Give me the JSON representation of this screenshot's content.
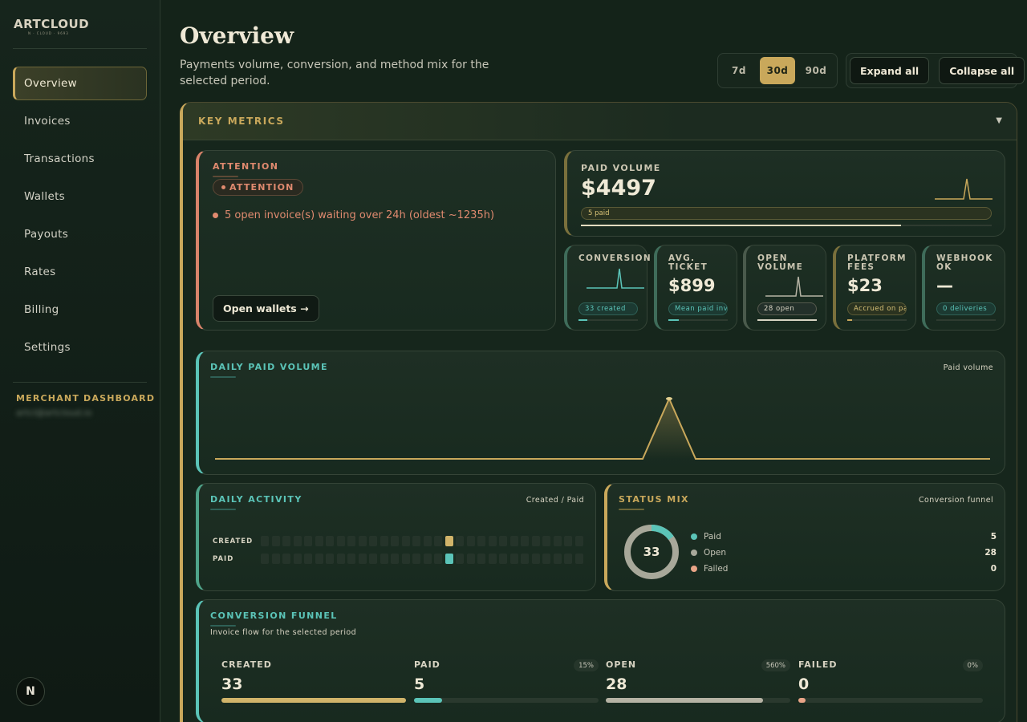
{
  "brand": {
    "logo_main": "ARTCLOUD",
    "logo_sub": "N · CLOUD · 9693"
  },
  "sidebar": {
    "items": [
      {
        "label": "Overview",
        "active": true
      },
      {
        "label": "Invoices"
      },
      {
        "label": "Transactions"
      },
      {
        "label": "Wallets"
      },
      {
        "label": "Payouts"
      },
      {
        "label": "Rates"
      },
      {
        "label": "Billing"
      },
      {
        "label": "Settings"
      }
    ],
    "merchant_label": "MERCHANT DASHBOARD",
    "merchant_email": "artcl@artcloud.io",
    "avatar_initial": "N"
  },
  "header": {
    "title": "Overview",
    "subtitle": "Payments volume, conversion, and method mix for the selected period.",
    "periods": [
      "7d",
      "30d",
      "90d"
    ],
    "active_period": "30d",
    "expand_all": "Expand all",
    "collapse_all": "Collapse all"
  },
  "key_metrics": {
    "title": "KEY METRICS",
    "caret": "▼",
    "attention": {
      "label": "ATTENTION",
      "pill": "ATTENTION",
      "message": "5 open invoice(s) waiting over 24h (oldest ~1235h)",
      "button": "Open wallets →"
    },
    "paid_volume": {
      "label": "PAID VOLUME",
      "value": "$4497",
      "pill": "5 paid",
      "progress": 0.78
    },
    "conversion": {
      "label": "CONVERSION",
      "pill": "33 created",
      "progress": 0.15
    },
    "avg_ticket": {
      "label": "AVG. TICKET",
      "value": "$899",
      "pill": "Mean paid invoice",
      "progress": 0.18
    },
    "open_volume": {
      "label": "OPEN VOLUME",
      "pill": "28 open",
      "progress": 1.0
    },
    "platform_fees": {
      "label": "PLATFORM FEES",
      "value": "$23",
      "pill": "Accrued on paid",
      "progress": 0.08
    },
    "webhook_ok": {
      "label": "WEBHOOK OK",
      "value": "—",
      "pill": "0 deliveries",
      "progress": 0
    }
  },
  "daily_paid_volume": {
    "label": "DAILY PAID VOLUME",
    "note": "Paid volume",
    "peak_day_index": 21,
    "days": 31
  },
  "daily_activity": {
    "label": "DAILY ACTIVITY",
    "note": "Created / Paid",
    "rows": [
      "CREATED",
      "PAID"
    ],
    "days": 30,
    "created_peak_index": 17,
    "paid_peak_index": 17
  },
  "status_mix": {
    "label": "STATUS MIX",
    "note": "Conversion funnel",
    "total": "33",
    "items": [
      {
        "name": "Paid",
        "value": 5,
        "color": "#5bc4b8"
      },
      {
        "name": "Open",
        "value": 28,
        "color": "#a8a89a"
      },
      {
        "name": "Failed",
        "value": 0,
        "color": "#e9a487"
      }
    ]
  },
  "conversion_funnel": {
    "label": "CONVERSION FUNNEL",
    "subtitle": "Invoice flow for the selected period",
    "stages": [
      {
        "label": "CREATED",
        "value": "33",
        "pct": "",
        "fraction": 1.0,
        "color": "#d1b46a"
      },
      {
        "label": "PAID",
        "value": "5",
        "pct": "15%",
        "fraction": 0.15,
        "color": "#5bc4b8"
      },
      {
        "label": "OPEN",
        "value": "28",
        "pct": "560%",
        "fraction": 0.85,
        "color": "#b6b3a4"
      },
      {
        "label": "FAILED",
        "value": "0",
        "pct": "0%",
        "fraction": 0.04,
        "color": "#e9a487"
      }
    ]
  },
  "colors": {
    "gold": "#c9a85b",
    "teal": "#5bc4b8",
    "coral": "#e08a6f",
    "bg": "#142319"
  }
}
